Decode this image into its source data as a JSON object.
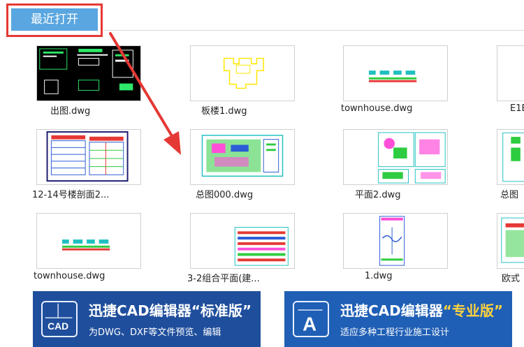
{
  "header": {
    "recent_label": "最近打开"
  },
  "files": [
    {
      "name": "出图.dwg"
    },
    {
      "name": "板楼1.dwg"
    },
    {
      "name": "townhouse.dwg"
    },
    {
      "name": "E1E"
    },
    {
      "name": "12-14号楼剖面2..."
    },
    {
      "name": "总图000.dwg"
    },
    {
      "name": "平面2.dwg"
    },
    {
      "name": "总图"
    },
    {
      "name": "townhouse.dwg"
    },
    {
      "name": "3-2组合平面(建..."
    },
    {
      "name": "1.dwg"
    },
    {
      "name": "欧式"
    }
  ],
  "banners": [
    {
      "title_main": "迅捷CAD编辑器",
      "title_edition": "“标准版”",
      "subtitle": "为DWG、DXF等文件预览、编辑",
      "icon_text": "CAD",
      "color": "#1f4e9c"
    },
    {
      "title_main": "迅捷CAD编辑器",
      "title_edition": "“专业版”",
      "subtitle": "适应多种工程行业施工设计",
      "icon_text": "A",
      "color": "#1f5fb5"
    }
  ],
  "colors": {
    "accent": "#5aa6e0",
    "highlight": "#e53935",
    "edition_gold": "#ffd23f"
  }
}
